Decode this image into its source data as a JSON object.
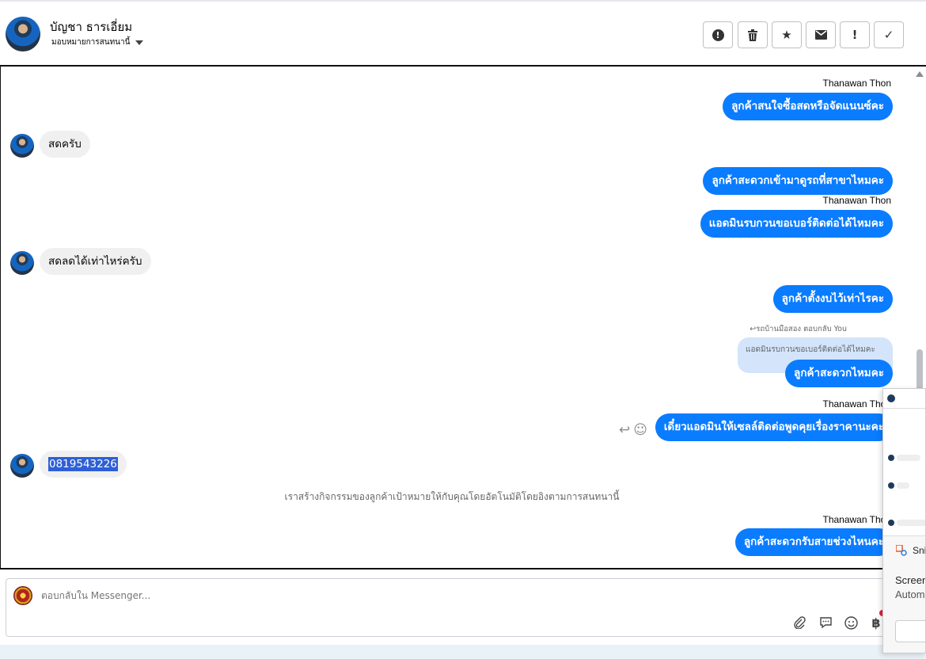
{
  "header": {
    "contact_name": "บัญชา ธารเอี่ยม",
    "assign_label": "มอบหมายการสนทนานี้",
    "toolbar": [
      {
        "name": "mark-spam-button",
        "icon": "alert-circle-icon",
        "glyph": "!"
      },
      {
        "name": "delete-button",
        "icon": "trash-icon",
        "glyph": "🗑"
      },
      {
        "name": "star-button",
        "icon": "star-icon",
        "glyph": "★"
      },
      {
        "name": "mark-unread-button",
        "icon": "envelope-icon",
        "glyph": "✉"
      },
      {
        "name": "follow-up-button",
        "icon": "exclamation-icon",
        "glyph": "!"
      },
      {
        "name": "mark-done-button",
        "icon": "check-icon",
        "glyph": "✓"
      }
    ]
  },
  "messages": {
    "m1_sender": "Thanawan Thon",
    "m1_text": "ลูกค้าสนใจซื้อสดหรือจัดแนนซ์คะ",
    "m2_text": "สดครับ",
    "m3_text": "ลูกค้าสะดวกเข้ามาดูรถที่สาขาไหมคะ",
    "m4_sender": "Thanawan Thon",
    "m4_text": "แอดมินรบกวนขอเบอร์ติดต่อได้ไหมคะ",
    "m5_text": "สดลดได้เท่าไหร่ครับ",
    "m6_text": "ลูกค้าตั้งงบไว้เท่าไรคะ",
    "m7_reply_hint": "รถบ้านมือสอง ตอบกลับ You",
    "m7_quoted": "แอดมินรบกวนขอเบอร์ติดต่อได้ไหมคะ",
    "m7_text": "ลูกค้าสะดวกไหมคะ",
    "m8_sender": "Thanawan Thon",
    "m8_text": "เดี๋ยวแอดมินให้เซลล์ติดต่อพูดคุยเรื่องราคานะคะ",
    "m9_text": "0819543226",
    "system_note": "เราสร้างกิจกรรมของลูกค้าเป้าหมายให้กับคุณโดยอัตโนมัติโดยอิงตามการสนทนานี้",
    "m10_sender": "Thanawan Thon",
    "m10_text": "ลูกค้าสะดวกรับสายช่วงไหนคะ"
  },
  "composer": {
    "placeholder": "ตอบกลับใน Messenger...",
    "icons": [
      "paperclip-icon",
      "quick-reply-icon",
      "emoji-icon",
      "baht-icon"
    ]
  },
  "overlay": {
    "snip_title": "Sni",
    "line1": "Screen",
    "line2": "Autom"
  }
}
